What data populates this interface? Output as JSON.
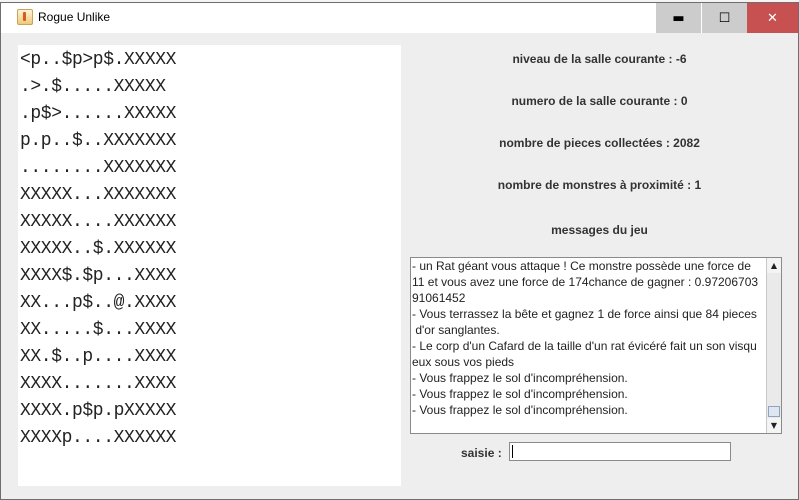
{
  "window": {
    "title": "Rogue Unlike",
    "icon": "java-cup-icon",
    "controls": {
      "minimize": "▬",
      "maximize": "☐",
      "close": "✕"
    }
  },
  "map": {
    "rows": [
      "<p..$p>p$.XXXXX",
      ".>.$.....XXXXX",
      ".p$>......XXXXX",
      "p.p..$..XXXXXXX",
      "........XXXXXXX",
      "XXXXX...XXXXXXX",
      "XXXXX....XXXXXX",
      "XXXXX..$.XXXXXX",
      "XXXX$.$p...XXXX",
      "XX...p$..@.XXXX",
      "XX.....$...XXXX",
      "XX.$..p....XXXX",
      "XXXX.......XXXX",
      "XXXX.p$p.pXXXXX",
      "XXXXp....XXXXXX"
    ]
  },
  "info": {
    "level": "niveau de la salle courante :   -6",
    "room": "numero de la salle courante :   0",
    "coins": "nombre de pieces collectées :  2082",
    "monsters": "nombre de monstres à proximité :  1",
    "messages_label": "messages du jeu"
  },
  "messages": {
    "lines": [
      "- un Rat géant vous attaque ! Ce monstre possède une force de",
      "11 et vous avez une force de 174chance de gagner : 0.97206703",
      "91061452",
      "- Vous terrassez la bête et gagnez 1 de force ainsi que 84 pieces",
      " d'or sanglantes.",
      "- Le corp d'un Cafard de la taille d'un rat évicéré fait un son visqu",
      "eux sous vos pieds",
      "- Vous frappez le sol d'incompréhension.",
      "- Vous frappez le sol d'incompréhension.",
      "- Vous frappez le sol d'incompréhension."
    ]
  },
  "input": {
    "label": "saisie :",
    "value": ""
  },
  "colors": {
    "close_button": "#c75050",
    "titlebar_buttons": "#cccccc",
    "panel_background": "#eeeeee"
  }
}
